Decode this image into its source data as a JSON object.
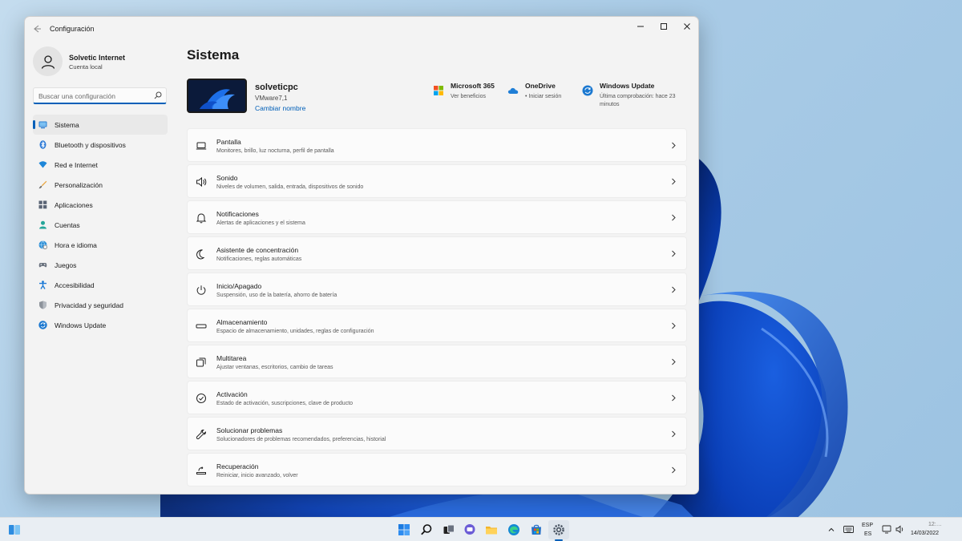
{
  "window": {
    "title": "Configuración"
  },
  "profile": {
    "name": "Solvetic Internet",
    "account_type": "Cuenta local"
  },
  "search": {
    "placeholder": "Buscar una configuración"
  },
  "nav": {
    "items": [
      {
        "label": "Sistema",
        "icon": "monitor-icon",
        "active": true
      },
      {
        "label": "Bluetooth y dispositivos",
        "icon": "bluetooth-icon"
      },
      {
        "label": "Red e Internet",
        "icon": "wifi-icon"
      },
      {
        "label": "Personalización",
        "icon": "brush-icon"
      },
      {
        "label": "Aplicaciones",
        "icon": "apps-icon"
      },
      {
        "label": "Cuentas",
        "icon": "person-icon"
      },
      {
        "label": "Hora e idioma",
        "icon": "globe-clock-icon"
      },
      {
        "label": "Juegos",
        "icon": "gamepad-icon"
      },
      {
        "label": "Accesibilidad",
        "icon": "accessibility-icon"
      },
      {
        "label": "Privacidad y seguridad",
        "icon": "shield-icon"
      },
      {
        "label": "Windows Update",
        "icon": "update-icon"
      }
    ]
  },
  "main": {
    "title": "Sistema",
    "device": {
      "name": "solveticpc",
      "model": "VMware7,1",
      "rename_link": "Cambiar nombre"
    },
    "quick_links": [
      {
        "title": "Microsoft 365",
        "subtitle": "Ver beneficios",
        "icon": "microsoft-logo-icon"
      },
      {
        "title": "OneDrive",
        "subtitle": "• Iniciar sesión",
        "icon": "onedrive-cloud-icon"
      },
      {
        "title": "Windows Update",
        "subtitle": "Última comprobación: hace 23 minutos",
        "icon": "update-icon"
      }
    ],
    "settings": [
      {
        "title": "Pantalla",
        "subtitle": "Monitores, brillo, luz nocturna, perfil de pantalla",
        "icon": "laptop-icon"
      },
      {
        "title": "Sonido",
        "subtitle": "Niveles de volumen, salida, entrada, dispositivos de sonido",
        "icon": "speaker-icon"
      },
      {
        "title": "Notificaciones",
        "subtitle": "Alertas de aplicaciones y el sistema",
        "icon": "bell-icon"
      },
      {
        "title": "Asistente de concentración",
        "subtitle": "Notificaciones, reglas automáticas",
        "icon": "moon-icon"
      },
      {
        "title": "Inicio/Apagado",
        "subtitle": "Suspensión, uso de la batería, ahorro de batería",
        "icon": "power-icon"
      },
      {
        "title": "Almacenamiento",
        "subtitle": "Espacio de almacenamiento, unidades, reglas de configuración",
        "icon": "storage-icon"
      },
      {
        "title": "Multitarea",
        "subtitle": "Ajustar ventanas, escritorios, cambio de tareas",
        "icon": "multitask-icon"
      },
      {
        "title": "Activación",
        "subtitle": "Estado de activación, suscripciones, clave de producto",
        "icon": "check-circle-icon"
      },
      {
        "title": "Solucionar problemas",
        "subtitle": "Solucionadores de problemas recomendados, preferencias, historial",
        "icon": "wrench-icon"
      },
      {
        "title": "Recuperación",
        "subtitle": "Reiniciar, inicio avanzado, volver",
        "icon": "recovery-icon"
      }
    ]
  },
  "taskbar": {
    "language_top": "ESP",
    "language_bottom": "ES",
    "time": "12:…",
    "date": "14/03/2022"
  },
  "colors": {
    "accent": "#005fb8",
    "window_bg": "#f3f3f3",
    "card_bg": "#fbfbfb"
  }
}
